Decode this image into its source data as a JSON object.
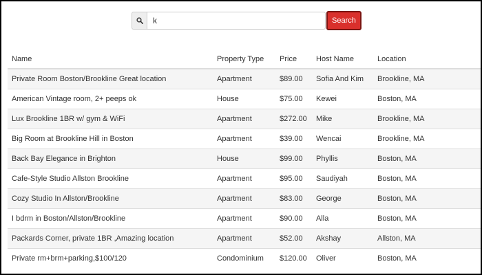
{
  "search": {
    "value": "k",
    "button_label": "Search",
    "icon": "search-icon"
  },
  "table": {
    "columns": [
      "Name",
      "Property Type",
      "Price",
      "Host Name",
      "Location"
    ],
    "rows": [
      [
        "Private Room Boston/Brookline Great location",
        "Apartment",
        "$89.00",
        "Sofia And Kim",
        "Brookline, MA"
      ],
      [
        "American Vintage room, 2+ peeps ok",
        "House",
        "$75.00",
        "Kewei",
        "Boston, MA"
      ],
      [
        "Lux Brookline 1BR w/ gym & WiFi",
        "Apartment",
        "$272.00",
        "Mike",
        "Brookline, MA"
      ],
      [
        "Big Room at Brookline Hill in Boston",
        "Apartment",
        "$39.00",
        "Wencai",
        "Brookline, MA"
      ],
      [
        "Back Bay Elegance in Brighton",
        "House",
        "$99.00",
        "Phyllis",
        "Boston, MA"
      ],
      [
        "Cafe-Style Studio Allston Brookline",
        "Apartment",
        "$95.00",
        "Saudiyah",
        "Boston, MA"
      ],
      [
        "Cozy Studio In Allston/Brookline",
        "Apartment",
        "$83.00",
        "George",
        "Boston, MA"
      ],
      [
        "I bdrm in Boston/Allston/Brookline",
        "Apartment",
        "$90.00",
        "Alla",
        "Boston, MA"
      ],
      [
        "Packards Corner, private 1BR ,Amazing location",
        "Apartment",
        "$52.00",
        "Akshay",
        "Allston, MA"
      ],
      [
        "Private rm+brm+parking,$100/120",
        "Condominium",
        "$120.00",
        "Oliver",
        "Boston, MA"
      ]
    ]
  }
}
